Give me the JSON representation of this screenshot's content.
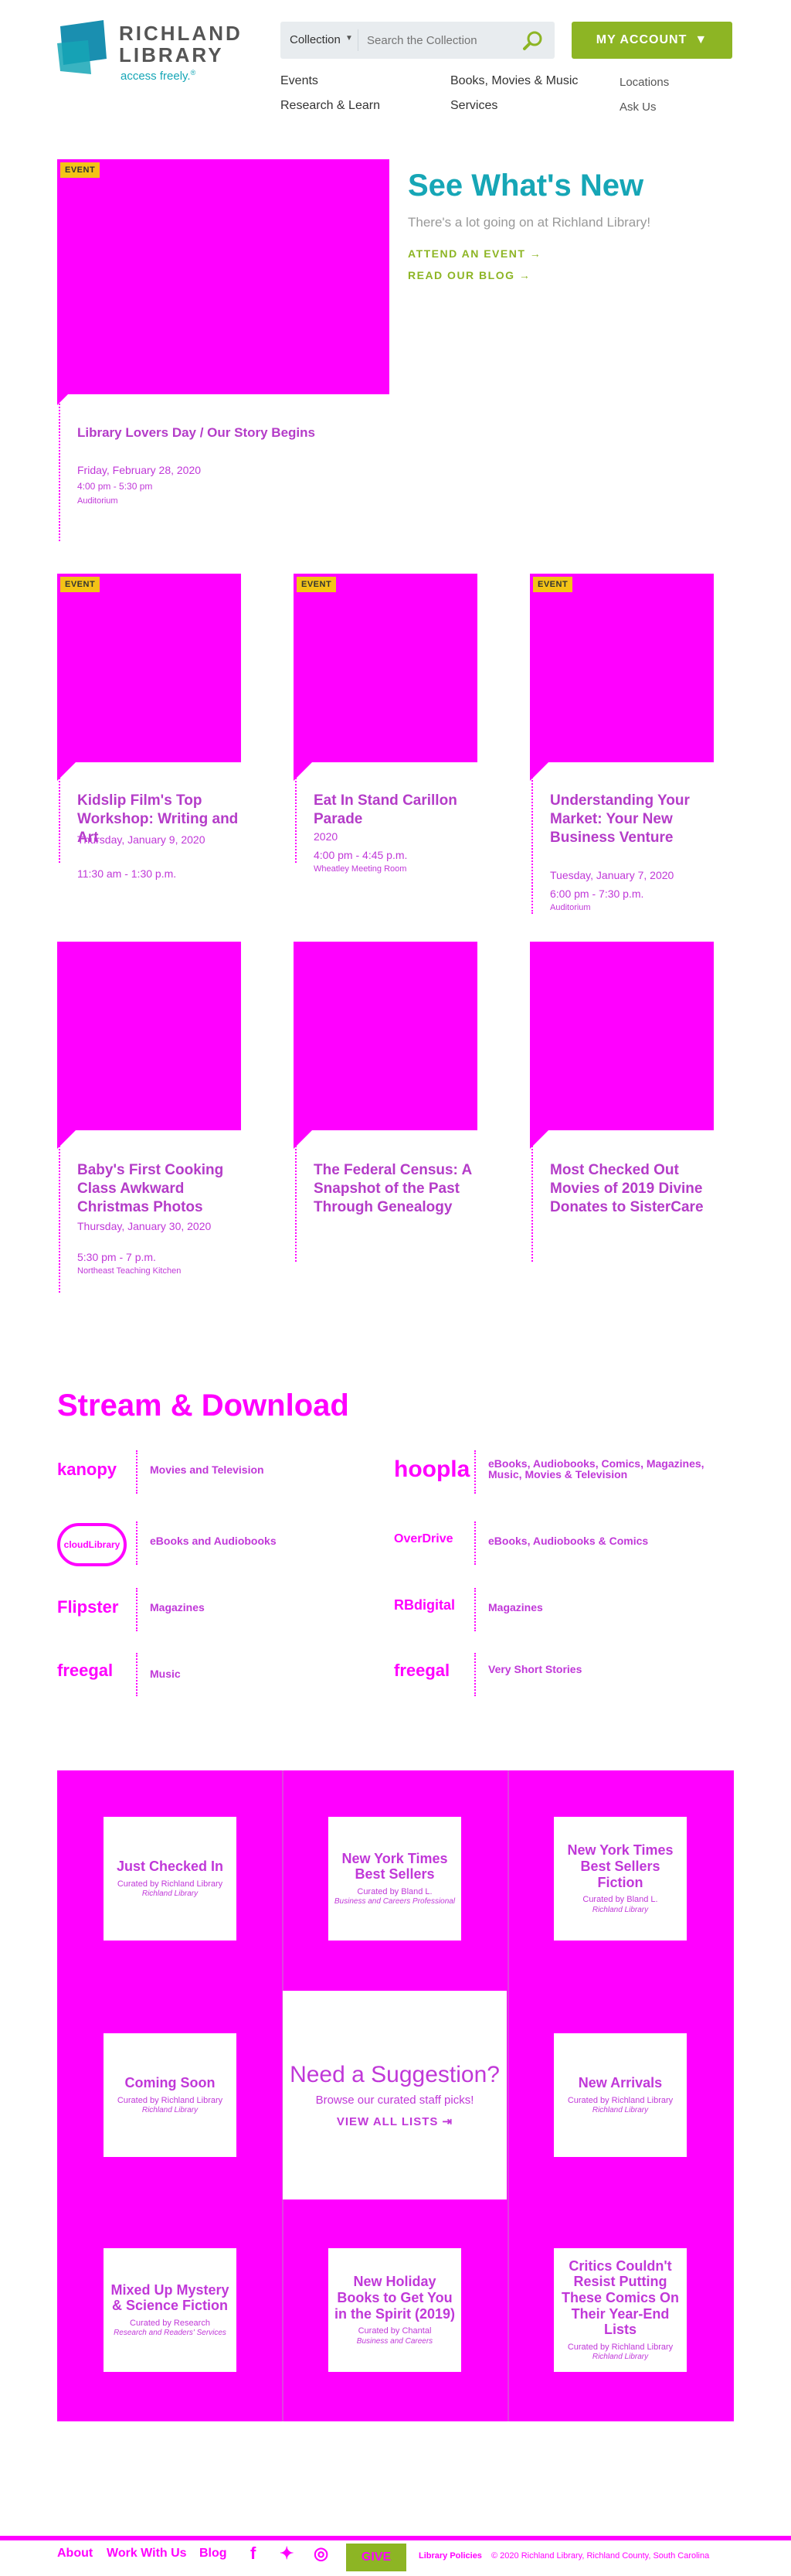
{
  "header": {
    "logo_line1": "RICHLAND",
    "logo_line2": "LIBRARY",
    "tagline": "access freely.",
    "search_scope": "Collection",
    "search_placeholder": "Search the Collection",
    "account_label": "MY ACCOUNT",
    "nav": [
      "Events",
      "Books, Movies & Music",
      "Research & Learn",
      "Services"
    ],
    "nav_secondary": [
      "Locations",
      "Ask Us"
    ]
  },
  "featured": {
    "badge": "EVENT",
    "title": "Library Lovers Day / Our Story Begins",
    "date": "Friday, February 28, 2020",
    "time": "4:00 pm - 5:30 pm",
    "room": "Auditorium"
  },
  "whats_new": {
    "title": "See What's New",
    "subtitle": "There's a lot going on at Richland Library!",
    "links": [
      "ATTEND AN EVENT →",
      "READ OUR BLOG →"
    ]
  },
  "events": [
    {
      "badge": "EVENT",
      "title": "Kidslip Film's Top Workshop: Writing and Art",
      "date": "Thursday, January 9, 2020",
      "time": "11:30 am - 1:30 p.m.",
      "room": ""
    },
    {
      "badge": "EVENT",
      "title": "Eat In Stand Carillon Parade",
      "date": "2020",
      "time": "4:00 pm - 4:45 p.m.",
      "room": "Wheatley Meeting Room"
    },
    {
      "badge": "EVENT",
      "title": "Understanding Your Market: Your New Business Venture",
      "date": "Tuesday, January 7, 2020",
      "time": "6:00 pm - 7:30 p.m.",
      "room": "Auditorium"
    }
  ],
  "blogs": [
    {
      "title": "Baby's First Cooking Class Awkward Christmas Photos",
      "date": "Thursday, January 30, 2020",
      "time": "5:30 pm - 7 p.m.",
      "room": "Northeast Teaching Kitchen"
    },
    {
      "title": "The Federal Census: A Snapshot of the Past Through Genealogy",
      "date": "",
      "time": "",
      "room": ""
    },
    {
      "title": "Most Checked Out Movies of 2019 Divine Donates to SisterCare",
      "date": "",
      "time": "",
      "room": ""
    }
  ],
  "stream": {
    "title": "Stream & Download",
    "services": [
      {
        "logo": "kanopy",
        "desc": "Movies and Television",
        "logo_icon": "kanopy-logo-icon"
      },
      {
        "logo": "hoopla",
        "desc": "eBooks, Audiobooks, Comics, Magazines, Music, Movies & Television",
        "logo_icon": "hoopla-logo-icon"
      },
      {
        "logo": "cloudLibrary",
        "desc": "eBooks and Audiobooks",
        "logo_icon": "cloudlibrary-logo-icon"
      },
      {
        "logo": "OverDrive",
        "desc": "eBooks, Audiobooks & Comics",
        "logo_icon": "overdrive-logo-icon"
      },
      {
        "logo": "Flipster",
        "desc": "Magazines",
        "logo_icon": "flipster-logo-icon"
      },
      {
        "logo": "RBdigital",
        "desc": "Magazines",
        "logo_icon": "rbdigital-logo-icon"
      },
      {
        "logo": "freegal",
        "desc": "Music",
        "logo_icon": "freegal-logo-icon"
      },
      {
        "logo": "freegal",
        "desc": "Very Short Stories",
        "logo_icon": "freegal-logo-icon"
      }
    ]
  },
  "lists": {
    "cards": [
      {
        "title": "Just Checked In",
        "curator": "Curated by Richland Library",
        "org": "Richland Library"
      },
      {
        "title": "New York Times Best Sellers",
        "curator": "Curated by Bland L.",
        "org": "Business and Careers Professional"
      },
      {
        "title": "New York Times Best Sellers Fiction",
        "curator": "Curated by Bland L.",
        "org": "Richland Library"
      },
      {
        "title": "Coming Soon",
        "curator": "Curated by Richland Library",
        "org": "Richland Library"
      },
      {
        "title": "New Arrivals",
        "curator": "Curated by Richland Library",
        "org": "Richland Library"
      },
      {
        "title": "Mixed Up Mystery & Science Fiction",
        "curator": "Curated by Research",
        "org": "Research and Readers' Services"
      },
      {
        "title": "New Holiday Books to Get You in the Spirit (2019)",
        "curator": "Curated by Chantal",
        "org": "Business and Careers"
      },
      {
        "title": "Critics Couldn't Resist Putting These Comics On Their Year-End Lists",
        "curator": "Curated by Richland Library",
        "org": "Richland Library"
      }
    ],
    "need_title": "Need a Suggestion?",
    "need_sub": "Browse our curated staff picks!",
    "need_link": "VIEW ALL LISTS ⇥"
  },
  "footer": {
    "links": [
      "About",
      "Work With Us",
      "Blog"
    ],
    "give": "GIVE",
    "policies": "Library Policies",
    "copyright": "© 2020 Richland Library, Richland County, South Carolina"
  },
  "colors": {
    "teal": "#16a6b6",
    "green": "#8db524",
    "placeholder": "#ff00ff",
    "badge": "#f3c316"
  }
}
